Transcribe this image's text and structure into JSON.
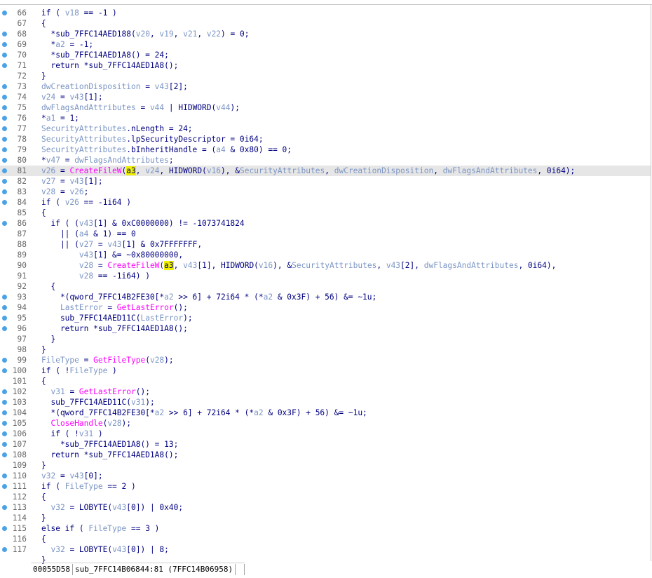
{
  "editor": {
    "lines": [
      {
        "n": "66",
        "dot": true,
        "tokens": [
          {
            "t": "if ( "
          },
          {
            "t": "v18",
            "c": "v"
          },
          {
            "t": " == -1 )"
          }
        ]
      },
      {
        "n": "67",
        "dot": false,
        "tokens": [
          {
            "t": "{"
          }
        ]
      },
      {
        "n": "68",
        "dot": true,
        "tokens": [
          {
            "t": "  *sub_7FFC14AED188("
          },
          {
            "t": "v20",
            "c": "v"
          },
          {
            "t": ", "
          },
          {
            "t": "v19",
            "c": "v"
          },
          {
            "t": ", "
          },
          {
            "t": "v21",
            "c": "v"
          },
          {
            "t": ", "
          },
          {
            "t": "v22",
            "c": "v"
          },
          {
            "t": ") = 0;"
          }
        ]
      },
      {
        "n": "69",
        "dot": true,
        "tokens": [
          {
            "t": "  *"
          },
          {
            "t": "a2",
            "c": "v"
          },
          {
            "t": " = -1;"
          }
        ]
      },
      {
        "n": "70",
        "dot": true,
        "tokens": [
          {
            "t": "  *sub_7FFC14AED1A8() = 24;"
          }
        ]
      },
      {
        "n": "71",
        "dot": true,
        "tokens": [
          {
            "t": "  return *sub_7FFC14AED1A8();"
          }
        ]
      },
      {
        "n": "72",
        "dot": false,
        "tokens": [
          {
            "t": "}"
          }
        ]
      },
      {
        "n": "73",
        "dot": true,
        "tokens": [
          {
            "t": "dwCreationDisposition",
            "c": "v"
          },
          {
            "t": " = "
          },
          {
            "t": "v43",
            "c": "v"
          },
          {
            "t": "[2];"
          }
        ]
      },
      {
        "n": "74",
        "dot": true,
        "tokens": [
          {
            "t": "v24",
            "c": "v"
          },
          {
            "t": " = "
          },
          {
            "t": "v43",
            "c": "v"
          },
          {
            "t": "[1];"
          }
        ]
      },
      {
        "n": "75",
        "dot": true,
        "tokens": [
          {
            "t": "dwFlagsAndAttributes",
            "c": "v"
          },
          {
            "t": " = "
          },
          {
            "t": "v44",
            "c": "v"
          },
          {
            "t": " | HIDWORD("
          },
          {
            "t": "v44",
            "c": "v"
          },
          {
            "t": ");"
          }
        ]
      },
      {
        "n": "76",
        "dot": true,
        "tokens": [
          {
            "t": "*"
          },
          {
            "t": "a1",
            "c": "v"
          },
          {
            "t": " = 1;"
          }
        ]
      },
      {
        "n": "77",
        "dot": true,
        "tokens": [
          {
            "t": "SecurityAttributes",
            "c": "v"
          },
          {
            "t": ".nLength = 24;"
          }
        ]
      },
      {
        "n": "78",
        "dot": true,
        "tokens": [
          {
            "t": "SecurityAttributes",
            "c": "v"
          },
          {
            "t": ".lpSecurityDescriptor = 0i64;"
          }
        ]
      },
      {
        "n": "79",
        "dot": true,
        "tokens": [
          {
            "t": "SecurityAttributes",
            "c": "v"
          },
          {
            "t": ".bInheritHandle = ("
          },
          {
            "t": "a4",
            "c": "v"
          },
          {
            "t": " & 0x80) == 0;"
          }
        ]
      },
      {
        "n": "80",
        "dot": true,
        "tokens": [
          {
            "t": "*"
          },
          {
            "t": "v47",
            "c": "v"
          },
          {
            "t": " = "
          },
          {
            "t": "dwFlagsAndAttributes",
            "c": "v"
          },
          {
            "t": ";"
          }
        ]
      },
      {
        "n": "81",
        "dot": true,
        "hl": true,
        "tokens": [
          {
            "t": "v26",
            "c": "v"
          },
          {
            "t": " = "
          },
          {
            "t": "CreateFileW",
            "c": "f"
          },
          {
            "t": "("
          },
          {
            "t": "a3",
            "c": "m"
          },
          {
            "t": ", "
          },
          {
            "t": "v24",
            "c": "v"
          },
          {
            "t": ", HIDWORD("
          },
          {
            "t": "v16",
            "c": "v"
          },
          {
            "t": "), &"
          },
          {
            "t": "SecurityAttributes",
            "c": "v"
          },
          {
            "t": ", "
          },
          {
            "t": "dwCreationDisposition",
            "c": "v"
          },
          {
            "t": ", "
          },
          {
            "t": "dwFlagsAndAttributes",
            "c": "v"
          },
          {
            "t": ", 0i64);"
          }
        ]
      },
      {
        "n": "82",
        "dot": true,
        "tokens": [
          {
            "t": "v27",
            "c": "v"
          },
          {
            "t": " = "
          },
          {
            "t": "v43",
            "c": "v"
          },
          {
            "t": "[1];"
          }
        ]
      },
      {
        "n": "83",
        "dot": true,
        "tokens": [
          {
            "t": "v28",
            "c": "v"
          },
          {
            "t": " = "
          },
          {
            "t": "v26",
            "c": "v"
          },
          {
            "t": ";"
          }
        ]
      },
      {
        "n": "84",
        "dot": true,
        "tokens": [
          {
            "t": "if ( "
          },
          {
            "t": "v26",
            "c": "v"
          },
          {
            "t": " == -1i64 )"
          }
        ]
      },
      {
        "n": "85",
        "dot": false,
        "tokens": [
          {
            "t": "{"
          }
        ]
      },
      {
        "n": "86",
        "dot": true,
        "tokens": [
          {
            "t": "  if ( ("
          },
          {
            "t": "v43",
            "c": "v"
          },
          {
            "t": "[1] & 0xC0000000) != -1073741824"
          }
        ]
      },
      {
        "n": "87",
        "dot": false,
        "tokens": [
          {
            "t": "    || ("
          },
          {
            "t": "a4",
            "c": "v"
          },
          {
            "t": " & 1) == 0"
          }
        ]
      },
      {
        "n": "88",
        "dot": false,
        "tokens": [
          {
            "t": "    || ("
          },
          {
            "t": "v27",
            "c": "v"
          },
          {
            "t": " = "
          },
          {
            "t": "v43",
            "c": "v"
          },
          {
            "t": "[1] & 0x7FFFFFFF,"
          }
        ]
      },
      {
        "n": "89",
        "dot": false,
        "tokens": [
          {
            "t": "        "
          },
          {
            "t": "v43",
            "c": "v"
          },
          {
            "t": "[1] &= ~0x80000000,"
          }
        ]
      },
      {
        "n": "90",
        "dot": false,
        "tokens": [
          {
            "t": "        "
          },
          {
            "t": "v28",
            "c": "v"
          },
          {
            "t": " = "
          },
          {
            "t": "CreateFileW",
            "c": "f"
          },
          {
            "t": "("
          },
          {
            "t": "a3",
            "c": "m"
          },
          {
            "t": ", "
          },
          {
            "t": "v43",
            "c": "v"
          },
          {
            "t": "[1], HIDWORD("
          },
          {
            "t": "v16",
            "c": "v"
          },
          {
            "t": "), &"
          },
          {
            "t": "SecurityAttributes",
            "c": "v"
          },
          {
            "t": ", "
          },
          {
            "t": "v43",
            "c": "v"
          },
          {
            "t": "[2], "
          },
          {
            "t": "dwFlagsAndAttributes",
            "c": "v"
          },
          {
            "t": ", 0i64),"
          }
        ]
      },
      {
        "n": "91",
        "dot": false,
        "tokens": [
          {
            "t": "        "
          },
          {
            "t": "v28",
            "c": "v"
          },
          {
            "t": " == -1i64) )"
          }
        ]
      },
      {
        "n": "92",
        "dot": false,
        "tokens": [
          {
            "t": "  {"
          }
        ]
      },
      {
        "n": "93",
        "dot": true,
        "tokens": [
          {
            "t": "    *(qword_7FFC14B2FE30[*"
          },
          {
            "t": "a2",
            "c": "v"
          },
          {
            "t": " >> 6] + 72i64 * (*"
          },
          {
            "t": "a2",
            "c": "v"
          },
          {
            "t": " & 0x3F) + 56) &= ~1u;"
          }
        ]
      },
      {
        "n": "94",
        "dot": true,
        "tokens": [
          {
            "t": "    "
          },
          {
            "t": "LastError",
            "c": "v"
          },
          {
            "t": " = "
          },
          {
            "t": "GetLastError",
            "c": "f"
          },
          {
            "t": "();"
          }
        ]
      },
      {
        "n": "95",
        "dot": true,
        "tokens": [
          {
            "t": "    sub_7FFC14AED11C("
          },
          {
            "t": "LastError",
            "c": "v"
          },
          {
            "t": ");"
          }
        ]
      },
      {
        "n": "96",
        "dot": true,
        "tokens": [
          {
            "t": "    return *sub_7FFC14AED1A8();"
          }
        ]
      },
      {
        "n": "97",
        "dot": false,
        "tokens": [
          {
            "t": "  }"
          }
        ]
      },
      {
        "n": "98",
        "dot": false,
        "tokens": [
          {
            "t": "}"
          }
        ]
      },
      {
        "n": "99",
        "dot": true,
        "tokens": [
          {
            "t": "FileType",
            "c": "v"
          },
          {
            "t": " = "
          },
          {
            "t": "GetFileType",
            "c": "f"
          },
          {
            "t": "("
          },
          {
            "t": "v28",
            "c": "v"
          },
          {
            "t": ");"
          }
        ]
      },
      {
        "n": "100",
        "dot": true,
        "tokens": [
          {
            "t": "if ( !"
          },
          {
            "t": "FileType",
            "c": "v"
          },
          {
            "t": " )"
          }
        ]
      },
      {
        "n": "101",
        "dot": false,
        "tokens": [
          {
            "t": "{"
          }
        ]
      },
      {
        "n": "102",
        "dot": true,
        "tokens": [
          {
            "t": "  "
          },
          {
            "t": "v31",
            "c": "v"
          },
          {
            "t": " = "
          },
          {
            "t": "GetLastError",
            "c": "f"
          },
          {
            "t": "();"
          }
        ]
      },
      {
        "n": "103",
        "dot": true,
        "tokens": [
          {
            "t": "  sub_7FFC14AED11C("
          },
          {
            "t": "v31",
            "c": "v"
          },
          {
            "t": ");"
          }
        ]
      },
      {
        "n": "104",
        "dot": true,
        "tokens": [
          {
            "t": "  *(qword_7FFC14B2FE30[*"
          },
          {
            "t": "a2",
            "c": "v"
          },
          {
            "t": " >> 6] + 72i64 * (*"
          },
          {
            "t": "a2",
            "c": "v"
          },
          {
            "t": " & 0x3F) + 56) &= ~1u;"
          }
        ]
      },
      {
        "n": "105",
        "dot": true,
        "tokens": [
          {
            "t": "  "
          },
          {
            "t": "CloseHandle",
            "c": "f"
          },
          {
            "t": "("
          },
          {
            "t": "v28",
            "c": "v"
          },
          {
            "t": ");"
          }
        ]
      },
      {
        "n": "106",
        "dot": true,
        "tokens": [
          {
            "t": "  if ( !"
          },
          {
            "t": "v31",
            "c": "v"
          },
          {
            "t": " )"
          }
        ]
      },
      {
        "n": "107",
        "dot": true,
        "tokens": [
          {
            "t": "    *sub_7FFC14AED1A8() = 13;"
          }
        ]
      },
      {
        "n": "108",
        "dot": true,
        "tokens": [
          {
            "t": "  return *sub_7FFC14AED1A8();"
          }
        ]
      },
      {
        "n": "109",
        "dot": false,
        "tokens": [
          {
            "t": "}"
          }
        ]
      },
      {
        "n": "110",
        "dot": true,
        "tokens": [
          {
            "t": "v32",
            "c": "v"
          },
          {
            "t": " = "
          },
          {
            "t": "v43",
            "c": "v"
          },
          {
            "t": "[0];"
          }
        ]
      },
      {
        "n": "111",
        "dot": true,
        "tokens": [
          {
            "t": "if ( "
          },
          {
            "t": "FileType",
            "c": "v"
          },
          {
            "t": " == 2 )"
          }
        ]
      },
      {
        "n": "112",
        "dot": false,
        "tokens": [
          {
            "t": "{"
          }
        ]
      },
      {
        "n": "113",
        "dot": true,
        "tokens": [
          {
            "t": "  "
          },
          {
            "t": "v32",
            "c": "v"
          },
          {
            "t": " = LOBYTE("
          },
          {
            "t": "v43",
            "c": "v"
          },
          {
            "t": "[0]) | 0x40;"
          }
        ]
      },
      {
        "n": "114",
        "dot": false,
        "tokens": [
          {
            "t": "}"
          }
        ]
      },
      {
        "n": "115",
        "dot": true,
        "tokens": [
          {
            "t": "else if ( "
          },
          {
            "t": "FileType",
            "c": "v"
          },
          {
            "t": " == 3 )"
          }
        ]
      },
      {
        "n": "116",
        "dot": false,
        "tokens": [
          {
            "t": "{"
          }
        ]
      },
      {
        "n": "117",
        "dot": true,
        "tokens": [
          {
            "t": "  "
          },
          {
            "t": "v32",
            "c": "v"
          },
          {
            "t": " = LOBYTE("
          },
          {
            "t": "v43",
            "c": "v"
          },
          {
            "t": "[0]) | 8;"
          }
        ]
      },
      {
        "n": "",
        "dot": false,
        "tokens": [
          {
            "t": "}"
          }
        ]
      }
    ]
  },
  "statusbar": {
    "address": "00055D58",
    "location": "sub_7FFC14B06844:81 (7FFC14B06958)"
  }
}
